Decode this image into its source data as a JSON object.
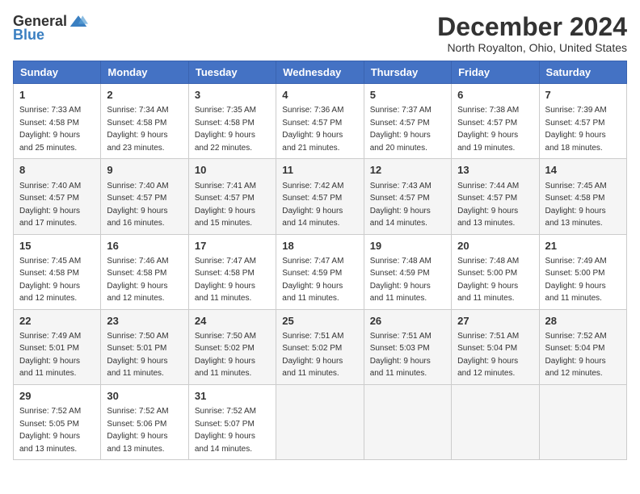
{
  "logo": {
    "general": "General",
    "blue": "Blue"
  },
  "title": "December 2024",
  "location": "North Royalton, Ohio, United States",
  "days_header": [
    "Sunday",
    "Monday",
    "Tuesday",
    "Wednesday",
    "Thursday",
    "Friday",
    "Saturday"
  ],
  "weeks": [
    [
      {
        "day": "1",
        "sunrise": "Sunrise: 7:33 AM",
        "sunset": "Sunset: 4:58 PM",
        "daylight": "Daylight: 9 hours and 25 minutes."
      },
      {
        "day": "2",
        "sunrise": "Sunrise: 7:34 AM",
        "sunset": "Sunset: 4:58 PM",
        "daylight": "Daylight: 9 hours and 23 minutes."
      },
      {
        "day": "3",
        "sunrise": "Sunrise: 7:35 AM",
        "sunset": "Sunset: 4:58 PM",
        "daylight": "Daylight: 9 hours and 22 minutes."
      },
      {
        "day": "4",
        "sunrise": "Sunrise: 7:36 AM",
        "sunset": "Sunset: 4:57 PM",
        "daylight": "Daylight: 9 hours and 21 minutes."
      },
      {
        "day": "5",
        "sunrise": "Sunrise: 7:37 AM",
        "sunset": "Sunset: 4:57 PM",
        "daylight": "Daylight: 9 hours and 20 minutes."
      },
      {
        "day": "6",
        "sunrise": "Sunrise: 7:38 AM",
        "sunset": "Sunset: 4:57 PM",
        "daylight": "Daylight: 9 hours and 19 minutes."
      },
      {
        "day": "7",
        "sunrise": "Sunrise: 7:39 AM",
        "sunset": "Sunset: 4:57 PM",
        "daylight": "Daylight: 9 hours and 18 minutes."
      }
    ],
    [
      {
        "day": "8",
        "sunrise": "Sunrise: 7:40 AM",
        "sunset": "Sunset: 4:57 PM",
        "daylight": "Daylight: 9 hours and 17 minutes."
      },
      {
        "day": "9",
        "sunrise": "Sunrise: 7:40 AM",
        "sunset": "Sunset: 4:57 PM",
        "daylight": "Daylight: 9 hours and 16 minutes."
      },
      {
        "day": "10",
        "sunrise": "Sunrise: 7:41 AM",
        "sunset": "Sunset: 4:57 PM",
        "daylight": "Daylight: 9 hours and 15 minutes."
      },
      {
        "day": "11",
        "sunrise": "Sunrise: 7:42 AM",
        "sunset": "Sunset: 4:57 PM",
        "daylight": "Daylight: 9 hours and 14 minutes."
      },
      {
        "day": "12",
        "sunrise": "Sunrise: 7:43 AM",
        "sunset": "Sunset: 4:57 PM",
        "daylight": "Daylight: 9 hours and 14 minutes."
      },
      {
        "day": "13",
        "sunrise": "Sunrise: 7:44 AM",
        "sunset": "Sunset: 4:57 PM",
        "daylight": "Daylight: 9 hours and 13 minutes."
      },
      {
        "day": "14",
        "sunrise": "Sunrise: 7:45 AM",
        "sunset": "Sunset: 4:58 PM",
        "daylight": "Daylight: 9 hours and 13 minutes."
      }
    ],
    [
      {
        "day": "15",
        "sunrise": "Sunrise: 7:45 AM",
        "sunset": "Sunset: 4:58 PM",
        "daylight": "Daylight: 9 hours and 12 minutes."
      },
      {
        "day": "16",
        "sunrise": "Sunrise: 7:46 AM",
        "sunset": "Sunset: 4:58 PM",
        "daylight": "Daylight: 9 hours and 12 minutes."
      },
      {
        "day": "17",
        "sunrise": "Sunrise: 7:47 AM",
        "sunset": "Sunset: 4:58 PM",
        "daylight": "Daylight: 9 hours and 11 minutes."
      },
      {
        "day": "18",
        "sunrise": "Sunrise: 7:47 AM",
        "sunset": "Sunset: 4:59 PM",
        "daylight": "Daylight: 9 hours and 11 minutes."
      },
      {
        "day": "19",
        "sunrise": "Sunrise: 7:48 AM",
        "sunset": "Sunset: 4:59 PM",
        "daylight": "Daylight: 9 hours and 11 minutes."
      },
      {
        "day": "20",
        "sunrise": "Sunrise: 7:48 AM",
        "sunset": "Sunset: 5:00 PM",
        "daylight": "Daylight: 9 hours and 11 minutes."
      },
      {
        "day": "21",
        "sunrise": "Sunrise: 7:49 AM",
        "sunset": "Sunset: 5:00 PM",
        "daylight": "Daylight: 9 hours and 11 minutes."
      }
    ],
    [
      {
        "day": "22",
        "sunrise": "Sunrise: 7:49 AM",
        "sunset": "Sunset: 5:01 PM",
        "daylight": "Daylight: 9 hours and 11 minutes."
      },
      {
        "day": "23",
        "sunrise": "Sunrise: 7:50 AM",
        "sunset": "Sunset: 5:01 PM",
        "daylight": "Daylight: 9 hours and 11 minutes."
      },
      {
        "day": "24",
        "sunrise": "Sunrise: 7:50 AM",
        "sunset": "Sunset: 5:02 PM",
        "daylight": "Daylight: 9 hours and 11 minutes."
      },
      {
        "day": "25",
        "sunrise": "Sunrise: 7:51 AM",
        "sunset": "Sunset: 5:02 PM",
        "daylight": "Daylight: 9 hours and 11 minutes."
      },
      {
        "day": "26",
        "sunrise": "Sunrise: 7:51 AM",
        "sunset": "Sunset: 5:03 PM",
        "daylight": "Daylight: 9 hours and 11 minutes."
      },
      {
        "day": "27",
        "sunrise": "Sunrise: 7:51 AM",
        "sunset": "Sunset: 5:04 PM",
        "daylight": "Daylight: 9 hours and 12 minutes."
      },
      {
        "day": "28",
        "sunrise": "Sunrise: 7:52 AM",
        "sunset": "Sunset: 5:04 PM",
        "daylight": "Daylight: 9 hours and 12 minutes."
      }
    ],
    [
      {
        "day": "29",
        "sunrise": "Sunrise: 7:52 AM",
        "sunset": "Sunset: 5:05 PM",
        "daylight": "Daylight: 9 hours and 13 minutes."
      },
      {
        "day": "30",
        "sunrise": "Sunrise: 7:52 AM",
        "sunset": "Sunset: 5:06 PM",
        "daylight": "Daylight: 9 hours and 13 minutes."
      },
      {
        "day": "31",
        "sunrise": "Sunrise: 7:52 AM",
        "sunset": "Sunset: 5:07 PM",
        "daylight": "Daylight: 9 hours and 14 minutes."
      },
      null,
      null,
      null,
      null
    ]
  ]
}
